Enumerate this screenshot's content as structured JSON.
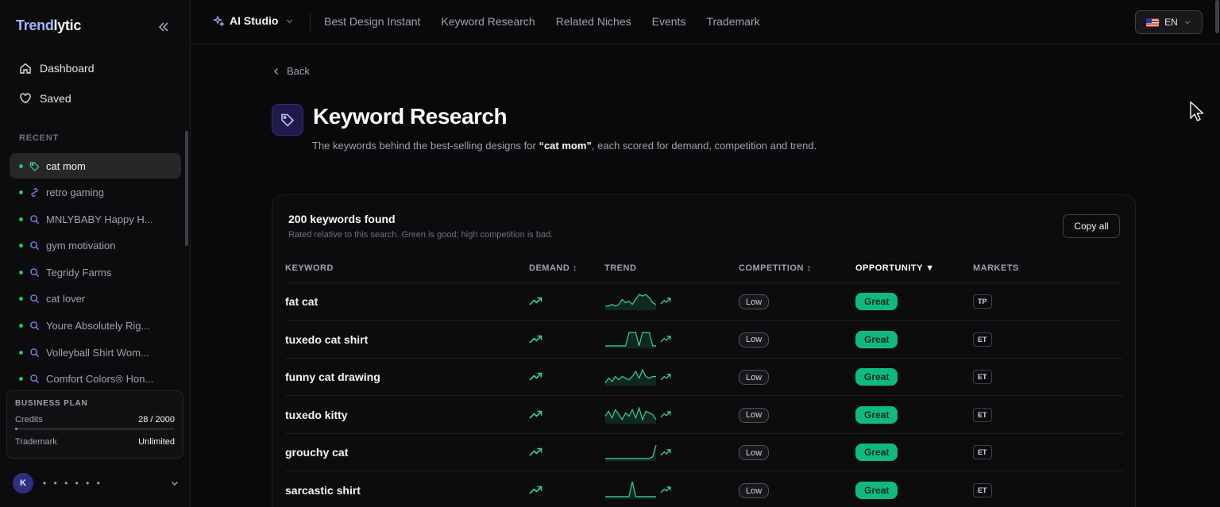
{
  "brand": {
    "part1": "Trend",
    "part2": "lytic"
  },
  "sidebar": {
    "nav": [
      {
        "label": "Dashboard",
        "icon": "home-icon"
      },
      {
        "label": "Saved",
        "icon": "heart-icon"
      }
    ],
    "recent_heading": "RECENT",
    "recent": [
      {
        "label": "cat mom",
        "icon": "tag-icon",
        "active": true
      },
      {
        "label": "retro gaming",
        "icon": "link-icon"
      },
      {
        "label": "MNLYBABY Happy H...",
        "icon": "search-icon"
      },
      {
        "label": "gym motivation",
        "icon": "search-icon"
      },
      {
        "label": "Tegridy Farms",
        "icon": "search-icon"
      },
      {
        "label": "cat lover",
        "icon": "search-icon"
      },
      {
        "label": "Youre Absolutely Rig...",
        "icon": "search-icon"
      },
      {
        "label": "Volleyball Shirt Wom...",
        "icon": "search-icon"
      },
      {
        "label": "Comfort Colors® Hon...",
        "icon": "search-icon"
      }
    ],
    "plan": {
      "title": "BUSINESS PLAN",
      "credits_label": "Credits",
      "credits_value": "28 / 2000",
      "credits_fraction": 0.014,
      "trademark_label": "Trademark",
      "trademark_value": "Unlimited"
    },
    "user": {
      "initial": "K",
      "name": "• • • • • •"
    }
  },
  "topbar": {
    "studio_label": "AI Studio",
    "links": [
      "Best Design Instant",
      "Keyword Research",
      "Related Niches",
      "Events",
      "Trademark"
    ],
    "language": "EN"
  },
  "main": {
    "back_label": "Back",
    "title": "Keyword Research",
    "desc_before": "The keywords behind the best-selling designs for ",
    "desc_term": "“cat mom”",
    "desc_after": ", each scored for demand, competition and trend."
  },
  "table": {
    "count_title": "200 keywords found",
    "subtitle": "Rated relative to this search. Green is good; high competition is bad.",
    "copy_label": "Copy all",
    "columns": {
      "keyword": "KEYWORD",
      "demand": "DEMAND ↕",
      "trend": "TREND",
      "competition": "COMPETITION ↕",
      "opportunity": "OPPORTUNITY ▼",
      "markets": "MARKETS"
    },
    "rows": [
      {
        "keyword": "fat cat",
        "competition": "Low",
        "opportunity": "Great",
        "market": "TP",
        "trend": [
          2,
          2,
          3,
          2,
          3,
          6,
          4,
          5,
          3,
          6,
          9,
          8,
          9,
          7,
          4,
          3
        ]
      },
      {
        "keyword": "tuxedo cat shirt",
        "competition": "Low",
        "opportunity": "Great",
        "market": "ET",
        "trend": [
          1,
          1,
          1,
          1,
          1,
          1,
          1,
          9,
          9,
          9,
          1,
          9,
          9,
          9,
          1,
          1
        ]
      },
      {
        "keyword": "funny cat drawing",
        "competition": "Low",
        "opportunity": "Great",
        "market": "ET",
        "trend": [
          1,
          4,
          2,
          5,
          3,
          5,
          4,
          3,
          5,
          8,
          4,
          9,
          5,
          4,
          5,
          5
        ]
      },
      {
        "keyword": "tuxedo kitty",
        "competition": "Low",
        "opportunity": "Great",
        "market": "ET",
        "trend": [
          4,
          7,
          3,
          8,
          5,
          2,
          6,
          4,
          8,
          3,
          9,
          2,
          7,
          6,
          5,
          2
        ]
      },
      {
        "keyword": "grouchy cat",
        "competition": "Low",
        "opportunity": "Great",
        "market": "ET",
        "trend": [
          1,
          1,
          1,
          1,
          1,
          1,
          1,
          1,
          1,
          1,
          1,
          1,
          1,
          1,
          2,
          9
        ]
      },
      {
        "keyword": "sarcastic shirt",
        "competition": "Low",
        "opportunity": "Great",
        "market": "ET",
        "trend": [
          1,
          1,
          1,
          1,
          1,
          1,
          1,
          1,
          10,
          1,
          1,
          1,
          1,
          1,
          1,
          1
        ]
      }
    ]
  }
}
